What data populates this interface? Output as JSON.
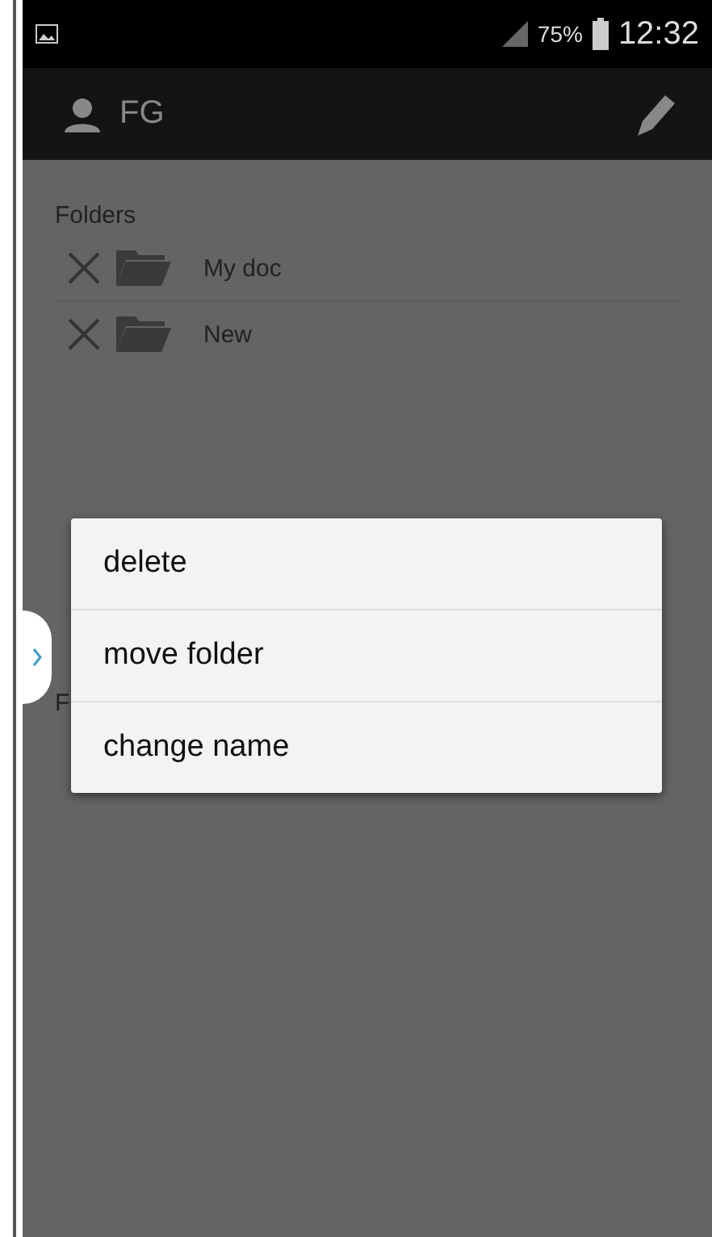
{
  "status_bar": {
    "battery": "75%",
    "time": "12:32"
  },
  "action_bar": {
    "title": "FG"
  },
  "sections": [
    {
      "title": "Folders",
      "folders": [
        {
          "name": "My doc"
        },
        {
          "name": "New"
        }
      ]
    },
    {
      "title": "F"
    }
  ],
  "context_menu": {
    "items": [
      {
        "label": "delete"
      },
      {
        "label": "move folder"
      },
      {
        "label": "change name"
      }
    ]
  }
}
